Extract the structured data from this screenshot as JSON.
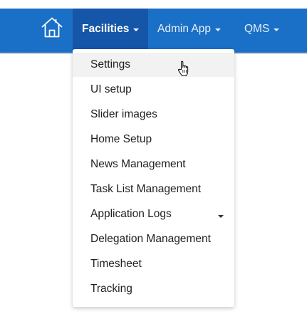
{
  "nav": {
    "home_icon": "home-icon",
    "items": [
      {
        "label": "Facilities",
        "active": true
      },
      {
        "label": "Admin App",
        "active": false
      },
      {
        "label": "QMS",
        "active": false
      }
    ]
  },
  "dropdown": {
    "items": [
      {
        "label": "Settings",
        "hovered": true
      },
      {
        "label": "UI setup"
      },
      {
        "label": "Slider images"
      },
      {
        "label": "Home Setup"
      },
      {
        "label": "News Management"
      },
      {
        "label": "Task List Management"
      },
      {
        "label": "Application Logs",
        "has_submenu": true
      },
      {
        "label": "Delegation Management"
      },
      {
        "label": "Timesheet"
      },
      {
        "label": "Tracking"
      }
    ]
  },
  "colors": {
    "topbar": "#1a6fc6",
    "active_nav": "#1556a8",
    "hover_item": "#f2f2f2",
    "menu_text": "#1f1f1f"
  }
}
